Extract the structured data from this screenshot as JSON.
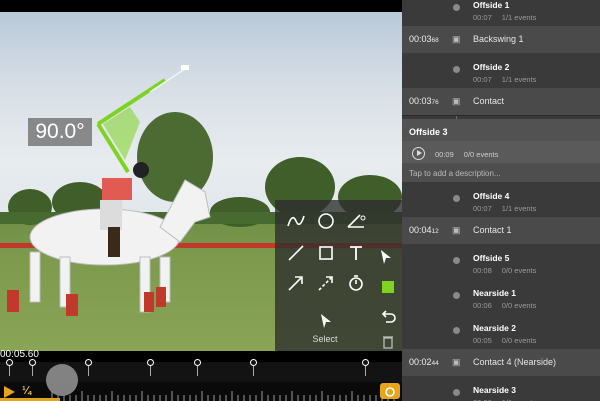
{
  "video": {
    "angle_value": "90.0°",
    "timecode": "00:05.60",
    "speed": "¼",
    "colors": {
      "accent": "#e7a417",
      "angle_line": "#7ed321"
    }
  },
  "tools": {
    "select_label": "Select",
    "icons": [
      "freehand-icon",
      "circle-icon",
      "angle-icon",
      "line-icon",
      "square-icon",
      "text-icon",
      "arrow-icon",
      "dashed-arrow-icon",
      "stopwatch-icon",
      "color-swatch-icon",
      "cursor-icon",
      "undo-icon",
      "trash-icon"
    ]
  },
  "panel": {
    "items": [
      {
        "kind": "clip",
        "title": "Offside 1",
        "duration": "00:07",
        "events": "1/1 events"
      },
      {
        "kind": "event",
        "time": "00:03",
        "time_frac": "68",
        "label": "Backswing 1"
      },
      {
        "kind": "clip",
        "title": "Offside 2",
        "duration": "00:07",
        "events": "1/1 events"
      },
      {
        "kind": "event",
        "time": "00:03",
        "time_frac": "76",
        "label": "Contact"
      },
      {
        "kind": "selected",
        "title": "Offside 3",
        "duration": "00:09",
        "events": "0/0 events",
        "description_placeholder": "Tap to add a description..."
      },
      {
        "kind": "clip",
        "title": "Offside 4",
        "duration": "00:07",
        "events": "1/1 events"
      },
      {
        "kind": "event",
        "time": "00:04",
        "time_frac": "12",
        "label": "Contact 1"
      },
      {
        "kind": "clip",
        "title": "Offside 5",
        "duration": "00:08",
        "events": "0/0 events"
      },
      {
        "kind": "clip",
        "title": "Nearside 1",
        "duration": "00:06",
        "events": "0/0 events"
      },
      {
        "kind": "clip",
        "title": "Nearside 2",
        "duration": "00:05",
        "events": "0/0 events"
      },
      {
        "kind": "event",
        "time": "00:02",
        "time_frac": "44",
        "label": "Contact 4 (Nearside)"
      },
      {
        "kind": "clip",
        "title": "Nearside 3",
        "duration": "00:06",
        "events": "1/1 events"
      }
    ]
  }
}
